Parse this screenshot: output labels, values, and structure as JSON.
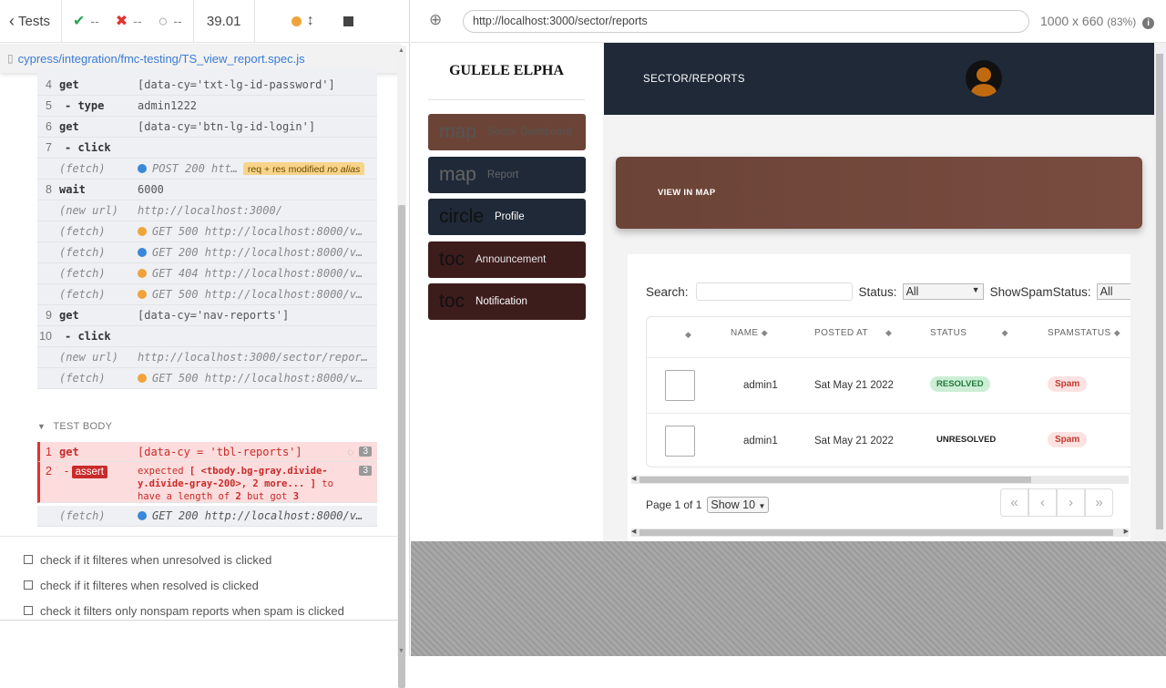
{
  "reporter": {
    "tests_label": "Tests",
    "passed": "--",
    "failed": "--",
    "pending": "--",
    "duration": "39.01",
    "spec_path": "cypress/integration/fmc-testing/TS_view_report.spec.js",
    "commands": [
      {
        "n": "4",
        "name": "get",
        "arg": "[data-cy='txt-lg-id-password']"
      },
      {
        "n": "5",
        "name": "- type",
        "arg": "admin1222"
      },
      {
        "n": "6",
        "name": "get",
        "arg": "[data-cy='btn-lg-id-login']"
      },
      {
        "n": "7",
        "name": "- click",
        "arg": ""
      },
      {
        "n": "",
        "name": "(fetch)",
        "arg": "POST 200 htt…",
        "badge": "req + res modified",
        "badge_alias": "no alias",
        "dot": "blue"
      },
      {
        "n": "8",
        "name": "wait",
        "arg": "6000"
      },
      {
        "n": "",
        "name": "(new url)",
        "arg": "http://localhost:3000/"
      },
      {
        "n": "",
        "name": "(fetch)",
        "arg": "GET 500 http://localhost:8000/v…",
        "dot": "orange"
      },
      {
        "n": "",
        "name": "(fetch)",
        "arg": "GET 200 http://localhost:8000/v…",
        "dot": "blue"
      },
      {
        "n": "",
        "name": "(fetch)",
        "arg": "GET 404 http://localhost:8000/v…",
        "dot": "orange"
      },
      {
        "n": "",
        "name": "(fetch)",
        "arg": "GET 500 http://localhost:8000/v…",
        "dot": "orange"
      },
      {
        "n": "9",
        "name": "get",
        "arg": "[data-cy='nav-reports']"
      },
      {
        "n": "10",
        "name": "- click",
        "arg": ""
      },
      {
        "n": "",
        "name": "(new url)",
        "arg": "http://localhost:3000/sector/repor…"
      },
      {
        "n": "",
        "name": "(fetch)",
        "arg": "GET 500 http://localhost:8000/v…",
        "dot": "orange"
      }
    ],
    "test_body_label": "TEST BODY",
    "body_get": {
      "n": "1",
      "name": "get",
      "arg": "[data-cy = 'tbl-reports']",
      "count": "3"
    },
    "body_assert": {
      "n": "2",
      "pill": "assert",
      "text_line1_a": "expected ",
      "text_line1_b": "[ <tbody.bg-gray.divide-",
      "text_line2": "y.divide-gray-200>, 2 more... ]",
      "text_line2_b": " to",
      "text_line3_a": "have a length of ",
      "text_line3_b": "2",
      "text_line3_c": " but got ",
      "text_line3_d": "3",
      "count": "3"
    },
    "body_fetch": {
      "name": "(fetch)",
      "arg": "GET 200 http://localhost:8000/v…"
    },
    "suite_tests": [
      "check if it filteres when unresolved is clicked",
      "check if it filteres when resolved is clicked",
      "check it filters only nonspam reports when spam is clicked"
    ]
  },
  "browser": {
    "url": "http://localhost:3000/sector/reports",
    "viewport": "1000 x 660",
    "scale": "(83%)"
  },
  "app": {
    "brand": "GULELE ELPHA",
    "nav": [
      {
        "icon": "map",
        "label": "Sector Dashboard",
        "bg": "#6b4437"
      },
      {
        "icon": "map",
        "label": "Report",
        "bg": "#1f2937"
      },
      {
        "icon": "circle",
        "label": "Profile",
        "bg": "#1f2937"
      },
      {
        "icon": "toc",
        "label": "Announcement",
        "bg": "#3d1c1c"
      },
      {
        "icon": "toc",
        "label": "Notification",
        "bg": "#3d1c1c"
      }
    ],
    "header_title": "SECTOR/REPORTS",
    "banner_label": "VIEW IN MAP",
    "filters": {
      "search_label": "Search:",
      "status_label": "Status:",
      "status_value": "All",
      "spam_label": "ShowSpamStatus:",
      "spam_value": "All"
    },
    "columns": [
      "NAME",
      "POSTED AT",
      "STATUS",
      "SPAMSTATUS"
    ],
    "rows": [
      {
        "name": "admin1",
        "posted": "Sat May 21 2022",
        "status": "RESOLVED",
        "spam": "Spam"
      },
      {
        "name": "admin1",
        "posted": "Sat May 21 2022",
        "status": "UNRESOLVED",
        "spam": "Spam"
      }
    ],
    "pager_text": "Page 1 of 1",
    "page_size": "Show 10"
  }
}
